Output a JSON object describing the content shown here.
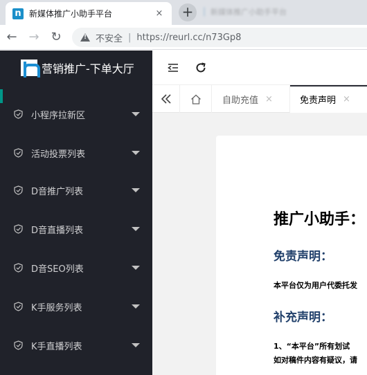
{
  "browser": {
    "tab": {
      "title": "新媒体推广小助手平台",
      "close": "×"
    },
    "newtab": "+",
    "background_tab": "新媒体推广小助手平台",
    "security_label": "不安全",
    "separator": "|",
    "url": "https://reurl.cc/n73Gp8"
  },
  "sidebar": {
    "logo_text": "营销推广-下单大厅",
    "items": [
      {
        "label": "小程序拉新区"
      },
      {
        "label": "活动投票列表"
      },
      {
        "label": "D音推广列表"
      },
      {
        "label": "D音直播列表"
      },
      {
        "label": "D音SEO列表"
      },
      {
        "label": "K手服务列表"
      },
      {
        "label": "K手直播列表"
      }
    ]
  },
  "pagetabs": [
    {
      "label": "自助充值",
      "close": "×"
    },
    {
      "label": "免责声明",
      "close": "×"
    }
  ],
  "document": {
    "title": "推广小助手：",
    "heading1": "免责声明：",
    "para1": "本平台仅为用户代委托发",
    "heading2": "补充声明：",
    "para2_line1": "1、“本平台”所有划试",
    "para2_line2": "如对稿件内容有疑议，请"
  },
  "colors": {
    "sidebar_bg": "#20222a",
    "accent": "#009688",
    "heading": "#21406b"
  }
}
